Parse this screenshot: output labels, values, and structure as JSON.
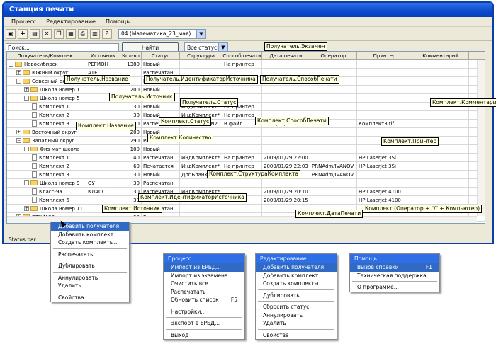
{
  "window": {
    "title": "Станция печати"
  },
  "menubar": [
    "Процесс",
    "Редактирование",
    "Помощь"
  ],
  "toolbar": {
    "exam": "04 (Математика_23_мая)",
    "status_filter": "Все статусы",
    "search_placeholder": "Поиск...",
    "find": "Найти"
  },
  "columns": [
    "Получатель/Комплект",
    "Источник",
    "Кол-во",
    "Статус",
    "Структура",
    "Способ печати",
    "Дата печати",
    "Оператор",
    "Принтер",
    "Комментарий"
  ],
  "rows": [
    [
      "Новосибирск",
      "РЕГИОН",
      "1380",
      "Новый",
      "",
      "На принтер",
      "",
      "",
      "",
      ""
    ],
    [
      "Южный округ",
      "АТЕ",
      "",
      "Распечатан",
      "",
      "",
      "",
      "",
      "",
      ""
    ],
    [
      "Северный округ",
      "АТЕ",
      "",
      "Новый",
      "",
      "",
      "",
      "",
      "",
      ""
    ],
    [
      "Школа номер 1",
      "",
      "200",
      "Новый",
      "",
      "",
      "",
      "",
      "",
      ""
    ],
    [
      "Школа номер 5",
      "",
      "200",
      "Новый",
      "",
      "",
      "",
      "",
      "",
      ""
    ],
    [
      "Комплект 1",
      "",
      "30",
      "Новый",
      "ИндКомплект*",
      "На принтер",
      "",
      "",
      "",
      ""
    ],
    [
      "Комплект 2",
      "",
      "30",
      "Новый",
      "ИндКомплект*",
      "На принтер",
      "",
      "",
      "",
      ""
    ],
    [
      "Комплект 3",
      "",
      "30",
      "Распечатан",
      "ДопБланкиN2",
      "В файл",
      "2009/01/29 22:02",
      "",
      "Комплект3.tif",
      ""
    ],
    [
      "Восточный округ",
      "",
      "200",
      "Новый",
      "",
      "",
      "",
      "",
      "",
      ""
    ],
    [
      "Западный округ",
      "",
      "290",
      "Распечатан",
      "",
      "",
      "",
      "",
      "",
      ""
    ],
    [
      "Физ-мат школа",
      "",
      "100",
      "Новый",
      "",
      "",
      "",
      "",
      "",
      ""
    ],
    [
      "Комплект 1",
      "",
      "40",
      "Распечатан",
      "ИндКомплект*",
      "На принтер",
      "2009/01/29 22:00",
      "",
      "HP LaserJet 3Si",
      ""
    ],
    [
      "Комплект 2",
      "",
      "60",
      "Печатается",
      "ИндКомплект*",
      "На принтер",
      "2009/01/29 22:03",
      "PRNAdm/IVANOV",
      "HP LaserJet 3Si",
      ""
    ],
    [
      "Комплект 3",
      "",
      "30",
      "Новый",
      "ДопБланкиN1",
      "",
      "",
      "PRNAdm/IVANOV",
      "",
      ""
    ],
    [
      "Школа номер 9",
      "ОУ",
      "30",
      "Распечатан",
      "",
      "",
      "",
      "",
      "",
      ""
    ],
    [
      "Класс-9а",
      "КЛАСС",
      "30",
      "Распечатан",
      "ИндКомплект*",
      "",
      "2009/01/29 20:10",
      "",
      "HP LaserJet 4100",
      ""
    ],
    [
      "Комплект 6",
      "",
      "30",
      "Распечатан",
      "ДопБланкиN2",
      "",
      "2009/01/29 20:15",
      "",
      "HP LaserJet 4100",
      ""
    ],
    [
      "Школа номер 11",
      "",
      "60",
      "Распечатан",
      "",
      "",
      "",
      "",
      "",
      ""
    ],
    [
      "ПТУ №23",
      "",
      "90",
      "Распечатан",
      "",
      "",
      "",
      "",
      "",
      ""
    ]
  ],
  "status_bar": "Status bar",
  "callouts": [
    "Получатель.Экзамен",
    "Получатель.Название",
    "Получатель.ИдентификаторИсточника",
    "Получатель.СпособПечати",
    "Получатель.Источник",
    "Получатель.Статус",
    "Комплект.Комментарий",
    "Комплект.Название",
    "Комплект.Статус",
    "Комплект.СпособПечати",
    "Комплект.Количество",
    "Комплект.Принтер",
    "Комплект.СтруктураКомплекта",
    "Комплект.ИдентификаторИсточника",
    "Комплект.Источник",
    "Комплект.ДатаПечати",
    "Комплект.(Оператор + \"/\" + Компьютер)"
  ],
  "context_menu": [
    "Добавить получателя",
    "Добавить комплект",
    "Создать комплекты...",
    "Распечатать",
    "Дублировать",
    "Аннулировать",
    "Удалить",
    "Свойства"
  ],
  "menu_process": {
    "title": "Процесс",
    "items": [
      "Импорт из ЕРБД...",
      "Импорт из экзамена...",
      "Очистить все",
      "Распечатать",
      "Обновить список",
      "Настройки...",
      "Экспорт в ЕРБД...",
      "Выход"
    ],
    "shortcut": "F5"
  },
  "menu_edit": {
    "title": "Редактирование",
    "items": [
      "Добавить получателя",
      "Добавить комплект",
      "Создать комплекты...",
      "Дублировать",
      "Сбросить статус",
      "Аннулировать",
      "Удалить",
      "Свойства"
    ]
  },
  "menu_help": {
    "title": "Помощь",
    "items": [
      "Вызов справки",
      "Техническая поддержка",
      "О программе..."
    ],
    "shortcut": "F1"
  }
}
